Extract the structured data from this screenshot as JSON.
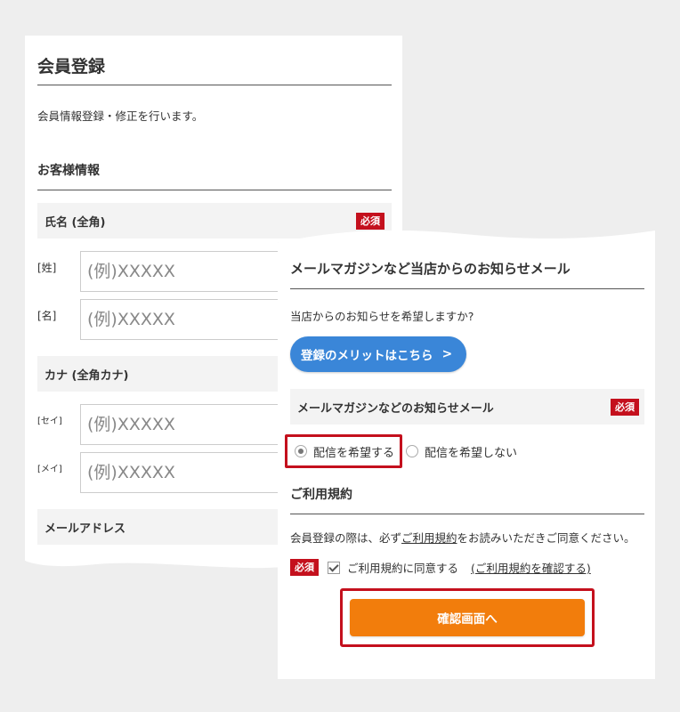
{
  "registration": {
    "title": "会員登録",
    "intro": "会員情報登録・修正を行います。",
    "section": "お客様情報",
    "required_badge": "必須",
    "name_field": {
      "label": "氏名 (全角)",
      "rows": [
        {
          "label": "[姓]",
          "placeholder": "(例)XXXXX"
        },
        {
          "label": "[名]",
          "placeholder": "(例)XXXXX"
        }
      ]
    },
    "kana_field": {
      "label": "カナ (全角カナ)",
      "rows": [
        {
          "label": "[セイ]",
          "placeholder": "(例)XXXXX"
        },
        {
          "label": "[メイ]",
          "placeholder": "(例)XXXXX"
        }
      ]
    },
    "email_field": {
      "label": "メールアドレス"
    }
  },
  "newsletter": {
    "title": "メールマガジンなど当店からのお知らせメール",
    "question": "当店からのお知らせを希望しますか?",
    "merit_button": "登録のメリットはこちら",
    "merit_arrow": ">",
    "field_label": "メールマガジンなどのお知らせメール",
    "required_badge": "必須",
    "options": [
      {
        "label": "配信を希望する",
        "selected": true
      },
      {
        "label": "配信を希望しない",
        "selected": false
      }
    ]
  },
  "terms": {
    "title": "ご利用規約",
    "text_before": "会員登録の際は、必ず",
    "text_link": "ご利用規約",
    "text_after": "をお読みいただきご同意ください。",
    "required_badge": "必須",
    "agree_label": "ご利用規約に同意する",
    "agree_checked": true,
    "view_link": "(ご利用規約を確認する)",
    "confirm_button": "確認画面へ"
  },
  "colors": {
    "required": "#c4101d",
    "merit_button": "#3a86d8",
    "confirm_button": "#f27d0c",
    "highlight_border": "#c4101d"
  }
}
